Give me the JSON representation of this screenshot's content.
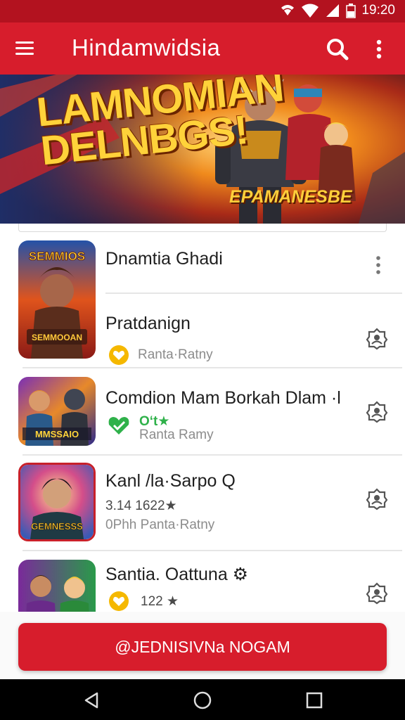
{
  "status": {
    "time": "19:20"
  },
  "app": {
    "title": "Hindamwidsia"
  },
  "banner": {
    "headline_line1": "LAMNOMIAN",
    "headline_line2": "DELNBGS!",
    "subtitle": "EPAMANESBE"
  },
  "list": {
    "items": [
      {
        "title": "Dnamtia Ghadi",
        "thumb_label": "SEMMIOS"
      },
      {
        "title": "Pratdanign",
        "meta": "Ranta·Ratny",
        "thumb_label": "SEMMOOAN"
      },
      {
        "title": "Comdion Mam Borkah Dlam ·l",
        "meta": "Ranta Ramy",
        "badge": "Oʻt★",
        "thumb_label": "MMSSAIO"
      },
      {
        "title": "Kanl /la·Sarpo Q",
        "meta_line1": "3.14 1622★",
        "meta_line2": "0Phh Panta·Ratny",
        "thumb_label": "GEMNESSS"
      },
      {
        "title": "Santia. Oattuna ⚙",
        "meta": "122 ★",
        "thumb_label": ""
      }
    ]
  },
  "cta": {
    "label": "@JEDNISIVNa NOGAM"
  },
  "colors": {
    "primary": "#d71d2c",
    "status": "#b3121f",
    "accent_gold": "#f5b800",
    "accent_green": "#2fb14a"
  },
  "icons": {
    "menu": "hamburger-icon",
    "search": "search-icon",
    "more": "more-vert-icon",
    "row_action": "badge-icon",
    "nav_back": "back-icon",
    "nav_home": "home-icon",
    "nav_recent": "recents-icon"
  }
}
